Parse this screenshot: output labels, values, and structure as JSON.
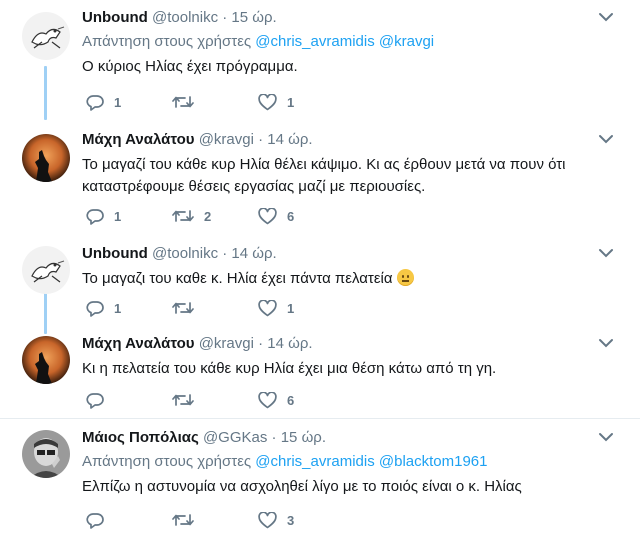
{
  "tweets": [
    {
      "name": "Unbound",
      "handle": "@toolnikc",
      "dot": "·",
      "time": "15 ώρ.",
      "replying": {
        "prefix": "Απάντηση στους χρήστες",
        "mentions": [
          "@chris_avramidis",
          "@kravgi"
        ]
      },
      "text": "Ο κύριος Ηλίας έχει πρόγραμμα.",
      "counts": {
        "reply": "1",
        "retweet": "",
        "like": "1"
      }
    },
    {
      "name": "Μάχη Αναλάτου",
      "handle": "@kravgi",
      "dot": "·",
      "time": "14 ώρ.",
      "text": "Το μαγαζί του κάθε κυρ Ηλία θέλει κάψιμο. Κι ας έρθουν μετά να πουν ότι καταστρέφουμε θέσεις εργασίας μαζί με περιουσίες.",
      "counts": {
        "reply": "1",
        "retweet": "2",
        "like": "6"
      }
    },
    {
      "name": "Unbound",
      "handle": "@toolnikc",
      "dot": "·",
      "time": "14 ώρ.",
      "text": "Το μαγαζι του καθε κ. Ηλία έχει πάντα πελατεία",
      "emoji": "neutral-face",
      "counts": {
        "reply": "1",
        "retweet": "",
        "like": "1"
      }
    },
    {
      "name": "Μάχη Αναλάτου",
      "handle": "@kravgi",
      "dot": "·",
      "time": "14 ώρ.",
      "text": "Κι η πελατεία του κάθε κυρ Ηλία έχει μια θέση κάτω από τη γη.",
      "counts": {
        "reply": "",
        "retweet": "",
        "like": "6"
      }
    },
    {
      "name": "Μάιος Ποπόλιας",
      "handle": "@GGKas",
      "dot": "·",
      "time": "15 ώρ.",
      "replying": {
        "prefix": "Απάντηση στους χρήστες",
        "mentions": [
          "@chris_avramidis",
          "@blacktom1961"
        ]
      },
      "text": "Ελπίζω η αστυνομία να ασχοληθεί λίγο με το ποιός είναι ο κ. Ηλίας",
      "counts": {
        "reply": "",
        "retweet": "",
        "like": "3"
      }
    }
  ],
  "icons": [
    "reply-icon",
    "retweet-icon",
    "like-icon",
    "chevron-down-icon"
  ],
  "colors": {
    "accent": "#1da1f2",
    "muted": "#657786",
    "text": "#14171a",
    "thread": "#9fd0f5",
    "divider": "#e6ecf0"
  }
}
